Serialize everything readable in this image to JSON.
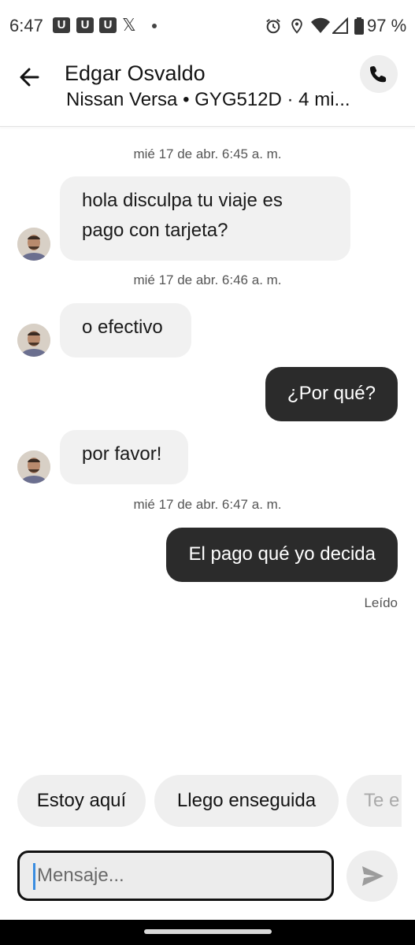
{
  "status_bar": {
    "time": "6:47",
    "app_icons": [
      "U",
      "U",
      "U"
    ],
    "x_icon": "𝕏",
    "battery": "97 %"
  },
  "header": {
    "contact_name": "Edgar Osvaldo",
    "subtitle": "Nissan Versa • GYG512D · 4 mi..."
  },
  "messages": [
    {
      "type": "timestamp",
      "text": "mié 17 de abr. 6:45 a. m."
    },
    {
      "type": "incoming",
      "text": "hola disculpa tu viaje es pago con tarjeta?"
    },
    {
      "type": "timestamp",
      "text": "mié 17 de abr. 6:46 a. m."
    },
    {
      "type": "incoming",
      "text": "o efectivo"
    },
    {
      "type": "outgoing",
      "text": "¿Por qué?"
    },
    {
      "type": "incoming",
      "text": "por favor!"
    },
    {
      "type": "timestamp",
      "text": "mié 17 de abr. 6:47 a. m."
    },
    {
      "type": "outgoing",
      "text": "El pago qué yo decida"
    }
  ],
  "read_status": "Leído",
  "quick_replies": [
    "Estoy aquí",
    "Llego enseguida",
    "Te e"
  ],
  "composer": {
    "placeholder": "Mensaje..."
  },
  "icons": {
    "back": "arrow-left-icon",
    "call": "phone-icon",
    "send": "send-icon"
  }
}
